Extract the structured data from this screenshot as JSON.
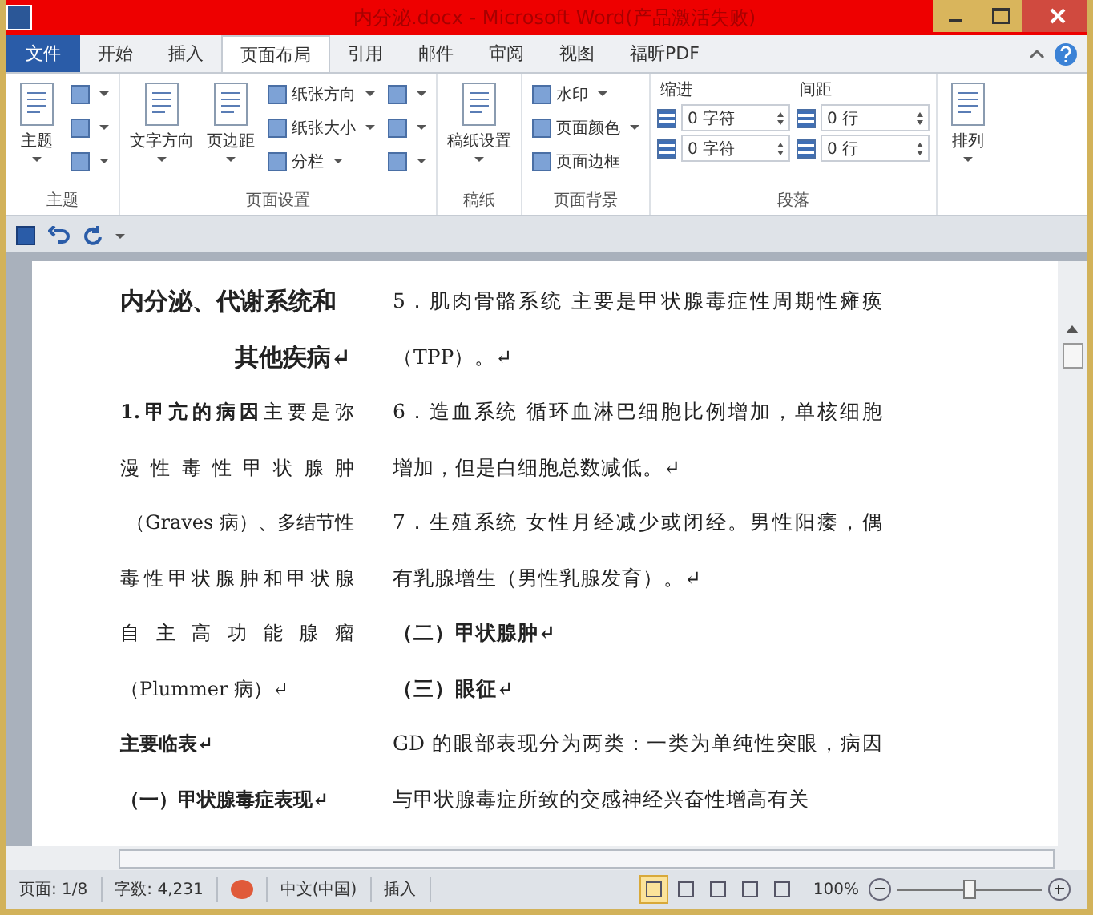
{
  "window": {
    "title": "内分泌.docx - Microsoft Word(产品激活失败)"
  },
  "tabs": [
    {
      "label": "文件",
      "kind": "file",
      "selected": false
    },
    {
      "label": "开始",
      "kind": "tab",
      "selected": false
    },
    {
      "label": "插入",
      "kind": "tab",
      "selected": false
    },
    {
      "label": "页面布局",
      "kind": "tab",
      "selected": true
    },
    {
      "label": "引用",
      "kind": "tab",
      "selected": false
    },
    {
      "label": "邮件",
      "kind": "tab",
      "selected": false
    },
    {
      "label": "审阅",
      "kind": "tab",
      "selected": false
    },
    {
      "label": "视图",
      "kind": "tab",
      "selected": false
    },
    {
      "label": "福昕PDF",
      "kind": "tab",
      "selected": false
    }
  ],
  "ribbon": {
    "groups": [
      {
        "label": "主题",
        "columns": [
          [
            {
              "kind": "large",
              "label": "主题"
            }
          ],
          [
            {
              "kind": "icon"
            },
            {
              "kind": "icon"
            },
            {
              "kind": "icon"
            }
          ]
        ]
      },
      {
        "label": "页面设置",
        "columns": [
          [
            {
              "kind": "large",
              "label": "文字方向"
            }
          ],
          [
            {
              "kind": "large",
              "label": "页边距"
            }
          ],
          [
            {
              "kind": "small",
              "label": "纸张方向"
            },
            {
              "kind": "small",
              "label": "纸张大小"
            },
            {
              "kind": "small",
              "label": "分栏"
            }
          ],
          [
            {
              "kind": "icon"
            },
            {
              "kind": "icon"
            },
            {
              "kind": "icon"
            }
          ]
        ]
      },
      {
        "label": "稿纸",
        "columns": [
          [
            {
              "kind": "large",
              "label": "稿纸设置"
            }
          ]
        ]
      },
      {
        "label": "页面背景",
        "columns": [
          [
            {
              "kind": "small",
              "label": "水印"
            },
            {
              "kind": "small",
              "label": "页面颜色"
            },
            {
              "kind": "plain",
              "label": "页面边框"
            }
          ]
        ]
      },
      {
        "label": "段落",
        "columns": [
          [
            {
              "kind": "heading",
              "label": "缩进"
            },
            {
              "kind": "spin",
              "value": "0 字符"
            },
            {
              "kind": "spin",
              "value": "0 字符"
            }
          ],
          [
            {
              "kind": "heading",
              "label": "间距"
            },
            {
              "kind": "spin",
              "value": "0 行"
            },
            {
              "kind": "spin",
              "value": "0 行"
            }
          ]
        ]
      },
      {
        "columns": [
          [
            {
              "kind": "large",
              "label": "排列"
            }
          ]
        ]
      }
    ]
  },
  "document": {
    "left": [
      {
        "kind": "title",
        "text": "内分泌、代谢系统和"
      },
      {
        "kind": "title-center",
        "text": "其他疾病↵"
      },
      {
        "kind": "justify",
        "text": "**1.甲亢的病因**主要是弥"
      },
      {
        "kind": "justify",
        "text": "漫性毒性甲状腺肿"
      },
      {
        "kind": "right",
        "text": "（Graves 病）、多结节性"
      },
      {
        "kind": "justify",
        "text": "毒性甲状腺肿和甲状腺"
      },
      {
        "kind": "justify",
        "text": "自主高功能腺瘤"
      },
      {
        "kind": "normal",
        "text": "（Plummer 病）↵"
      },
      {
        "kind": "bold",
        "text": "主要临表↵"
      },
      {
        "kind": "bold",
        "text": "（一）甲状腺毒症表现↵"
      }
    ],
    "right": [
      {
        "kind": "justify",
        "text": "5．肌肉骨骼系统 主要是甲状腺毒症性周期性瘫痪"
      },
      {
        "kind": "normal",
        "text": "（TPP）。↵"
      },
      {
        "kind": "justify",
        "text": "6．造血系统 循环血淋巴细胞比例增加，单核细胞"
      },
      {
        "kind": "normal",
        "text": "增加，但是白细胞总数减低。↵"
      },
      {
        "kind": "justify",
        "text": "7．生殖系统 女性月经减少或闭经。男性阳痿，偶"
      },
      {
        "kind": "normal",
        "text": "有乳腺增生（男性乳腺发育）。↵"
      },
      {
        "kind": "bold",
        "text": "（二）甲状腺肿↵"
      },
      {
        "kind": "bold",
        "text": "（三）眼征↵"
      },
      {
        "kind": "justify",
        "text": "GD 的眼部表现分为两类：一类为单纯性突眼，病因"
      },
      {
        "kind": "normal",
        "text": "与甲状腺毒症所致的交感神经兴奋性增高有关"
      }
    ]
  },
  "status_bar": {
    "page": "页面: 1/8",
    "words": "字数: 4,231",
    "language": "中文(中国)",
    "mode": "插入",
    "views": [
      {
        "selected": true
      },
      {
        "selected": false
      },
      {
        "selected": false
      },
      {
        "selected": false
      },
      {
        "selected": false
      }
    ],
    "zoom": "100%",
    "zoom_slider": {
      "level": 0.5
    }
  }
}
